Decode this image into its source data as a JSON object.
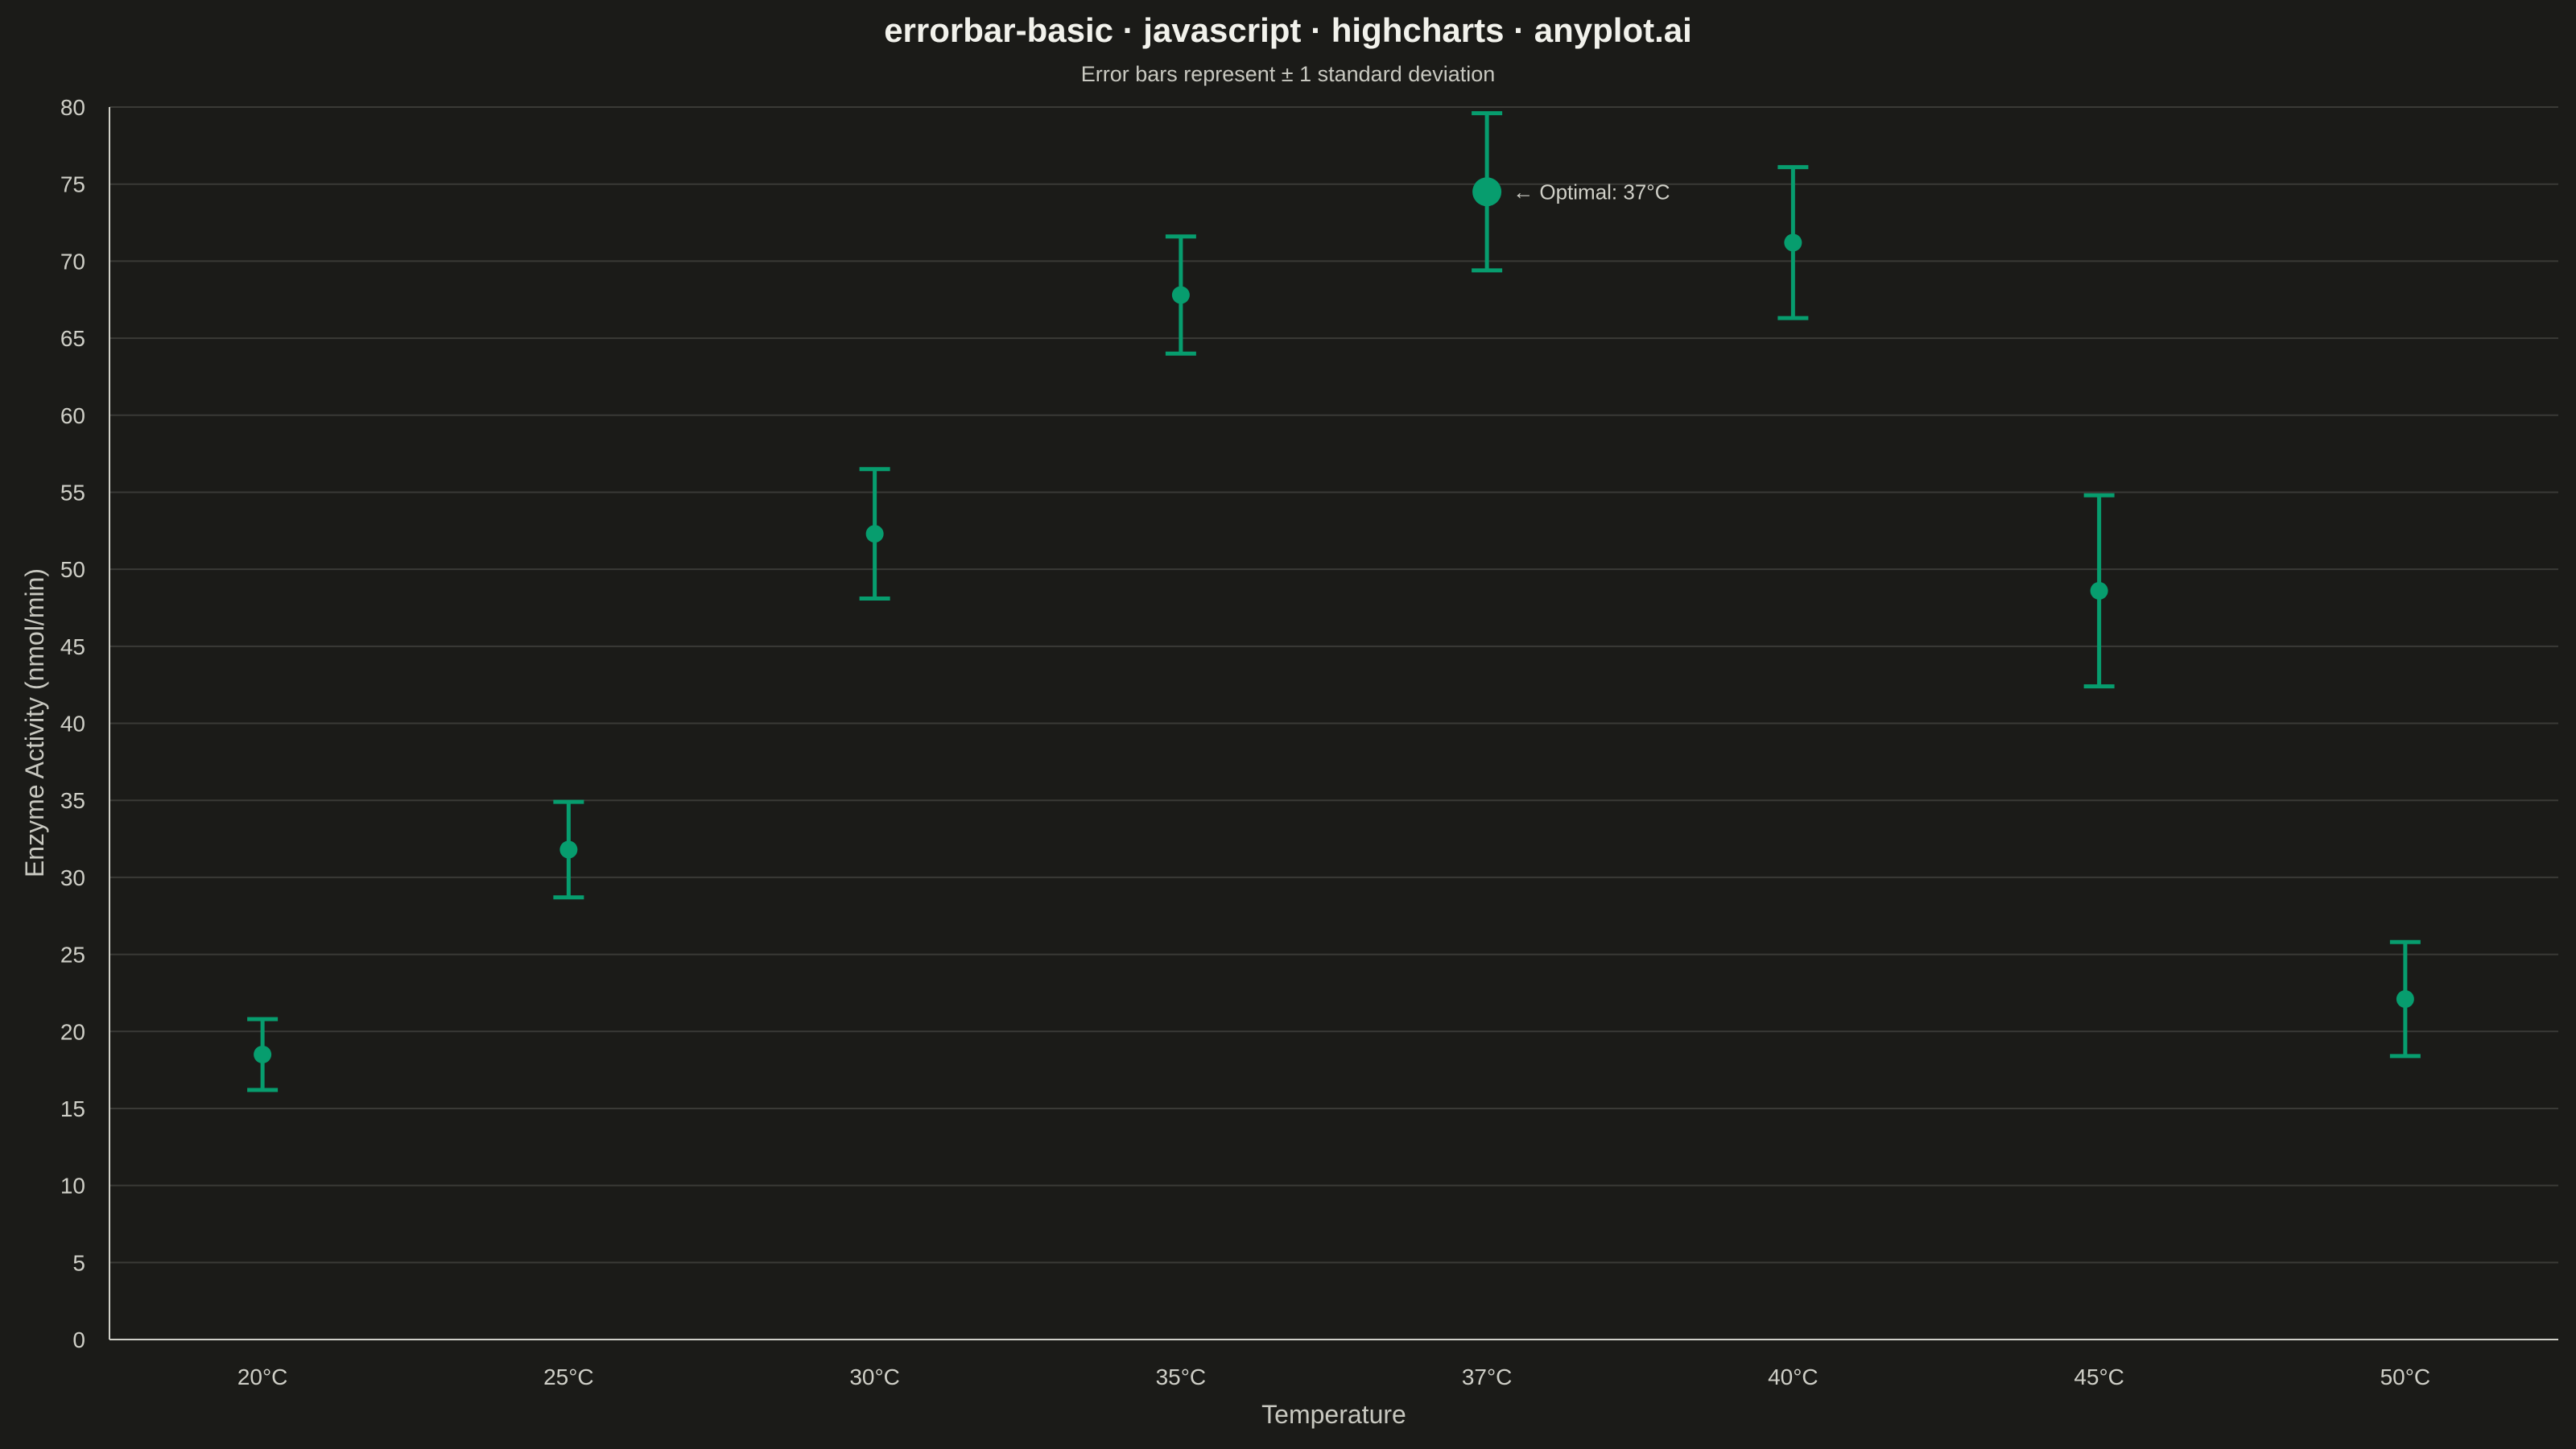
{
  "chart_data": {
    "type": "errorbar",
    "title": "errorbar-basic · javascript · highcharts · anyplot.ai",
    "subtitle": "Error bars represent ± 1 standard deviation",
    "xlabel": "Temperature",
    "ylabel": "Enzyme Activity (nmol/min)",
    "ylim": [
      0,
      80
    ],
    "yticks": [
      0,
      5,
      10,
      15,
      20,
      25,
      30,
      35,
      40,
      45,
      50,
      55,
      60,
      65,
      70,
      75,
      80
    ],
    "grid": true,
    "categories": [
      "20°C",
      "25°C",
      "30°C",
      "35°C",
      "37°C",
      "40°C",
      "45°C",
      "50°C"
    ],
    "values": [
      18.5,
      31.8,
      52.3,
      67.8,
      74.5,
      71.2,
      48.6,
      22.1
    ],
    "error_low": [
      16.2,
      28.7,
      48.1,
      64.0,
      69.4,
      66.3,
      42.4,
      18.4
    ],
    "error_high": [
      20.8,
      34.9,
      56.5,
      71.6,
      79.6,
      76.1,
      54.8,
      25.8
    ],
    "highlight_index": 4,
    "annotation": {
      "text": "← Optimal: 37°C",
      "index": 4
    },
    "colors": {
      "series": "#079d6e",
      "background": "#1b1b18"
    }
  }
}
